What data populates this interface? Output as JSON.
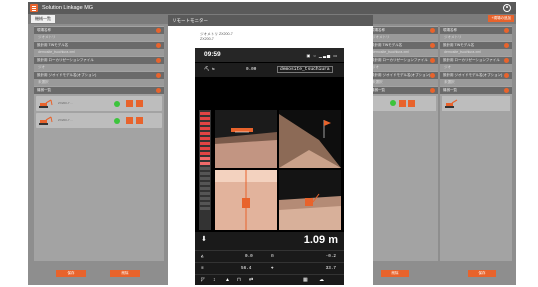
{
  "app": {
    "title": "Solution Linkage MG",
    "tab_label": "機械一覧",
    "corner_button": "+現場の追加",
    "colors": {
      "accent": "#e8632c",
      "topbar": "#5a5a5a",
      "status_green": "#3cc43c"
    }
  },
  "left_panel": {
    "sections": [
      {
        "title": "現場名称",
        "value": "ジオメトリ"
      },
      {
        "title": "設計用 TINモデル名",
        "value": "demosite_tsuchiura.xml"
      },
      {
        "title": "設計用 ローカリゼーションファイル",
        "value": "ジオ"
      },
      {
        "title": "設計用 ジオイドモデル名(オプション)",
        "value": "未選択"
      },
      {
        "title": "機械一覧",
        "value": ""
      }
    ],
    "machines": [
      {
        "id": "ZX200-7  ..."
      },
      {
        "id": "ZX200-7  ..."
      }
    ],
    "buttons": {
      "left": "保存",
      "right": "削除"
    }
  },
  "right_panel": {
    "sections": [
      {
        "title": "現場名称",
        "value": "ジオメトリ"
      },
      {
        "title": "設計用 TINモデル名",
        "value": "demosite_tsuchiura.xml"
      },
      {
        "title": "設計用 ローカリゼーションファイル",
        "value": "ジオ"
      },
      {
        "title": "設計用 ジオイドモデル名(オプション)",
        "value": "未選択"
      },
      {
        "title": "機械一覧",
        "value": ""
      }
    ],
    "buttons": {
      "mid": "削除",
      "right": "保存"
    }
  },
  "modal": {
    "title": "リモートモニター",
    "info_line1": "ジオメトリ ZX200-7",
    "info_line2": "ZX200-7"
  },
  "phone": {
    "time": "09:59",
    "status_icons": "▣ ○ ▁▃▅ ▭",
    "site_name": "demosite_tsuchiura",
    "elevation": "0.00",
    "distance": "1.09 m",
    "row1_left": "0.0",
    "row1_right": "-0.2",
    "row2_left": "56.4",
    "row2_right": "33.7"
  }
}
